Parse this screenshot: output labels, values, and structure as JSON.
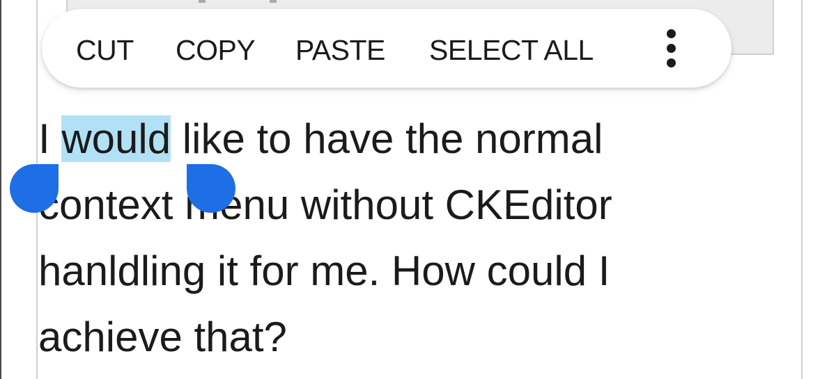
{
  "context_menu": {
    "cut_label": "CUT",
    "copy_label": "COPY",
    "paste_label": "PASTE",
    "select_all_label": "SELECT ALL",
    "more_icon": "more-vert-icon"
  },
  "editor": {
    "line1_before": "I ",
    "line1_selected": "would",
    "line1_after": " like to have the normal",
    "line2": "context menu without CKEditor",
    "line3": "hanldling it for me. How could I",
    "line4": "achieve that?"
  },
  "colors": {
    "selection_highlight": "#b2e1f5",
    "selection_handle": "#1e6fe6",
    "text": "#1b1b1b"
  }
}
